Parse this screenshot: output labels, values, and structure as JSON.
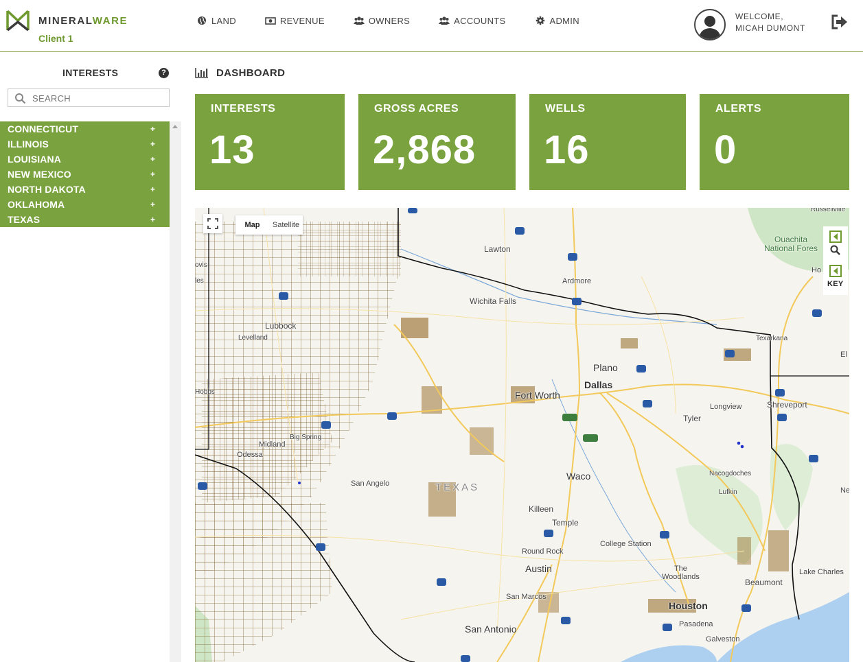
{
  "brand": {
    "name_dark": "MINERAL",
    "name_accent": "WARE",
    "client": "Client 1",
    "accent_color": "#6f9a2f"
  },
  "nav": [
    {
      "label": "LAND",
      "icon": "globe-icon"
    },
    {
      "label": "REVENUE",
      "icon": "money-icon"
    },
    {
      "label": "OWNERS",
      "icon": "users-icon"
    },
    {
      "label": "ACCOUNTS",
      "icon": "group-icon"
    },
    {
      "label": "ADMIN",
      "icon": "gear-icon"
    }
  ],
  "user": {
    "welcome": "WELCOME,",
    "name": "MICAH DUMONT"
  },
  "sidebar": {
    "title": "INTERESTS",
    "search_placeholder": "SEARCH",
    "states": [
      "CONNECTICUT",
      "ILLINOIS",
      "LOUISIANA",
      "NEW MEXICO",
      "NORTH DAKOTA",
      "OKLAHOMA",
      "TEXAS"
    ],
    "expand_symbol": "+"
  },
  "dashboard": {
    "title": "DASHBOARD",
    "cards": [
      {
        "label": "INTERESTS",
        "value": "13"
      },
      {
        "label": "GROSS ACRES",
        "value": "2,868"
      },
      {
        "label": "WELLS",
        "value": "16"
      },
      {
        "label": "ALERTS",
        "value": "0"
      }
    ],
    "card_color": "#7aa33f"
  },
  "map": {
    "type_buttons": [
      "Map",
      "Satellite"
    ],
    "key_label": "KEY",
    "labels": {
      "lawton": "Lawton",
      "ardmore": "Ardmore",
      "wichita_falls": "Wichita Falls",
      "lubbock": "Lubbock",
      "levelland": "Levelland",
      "plano": "Plano",
      "dallas": "Dallas",
      "fort_worth": "Fort Worth",
      "tyler": "Tyler",
      "longview": "Longview",
      "shreveport": "Shreveport",
      "texarkana": "Texarkana",
      "waco": "Waco",
      "texas": "TEXAS",
      "san_angelo": "San Angelo",
      "midland": "Midland",
      "odessa": "Odessa",
      "big_spring": "Big Spring",
      "killeen": "Killeen",
      "temple": "Temple",
      "college_station": "College Station",
      "round_rock": "Round Rock",
      "austin": "Austin",
      "san_marcos": "San Marcos",
      "san_antonio": "San Antonio",
      "the_woodlands": "The\nWoodlands",
      "houston": "Houston",
      "pasadena": "Pasadena",
      "galveston": "Galveston",
      "beaumont": "Beaumont",
      "lake_charles": "Lake Charles",
      "nacogdoches": "Nacogdoches",
      "lufkin": "Lufkin",
      "ouachita": "Ouachita\nNational Fores",
      "russellville": "Russellville",
      "el": "El",
      "ne": "Ne",
      "ho": "Ho",
      "hobbs": "Hobbs",
      "clovis": "ovis",
      "les": "les"
    }
  }
}
